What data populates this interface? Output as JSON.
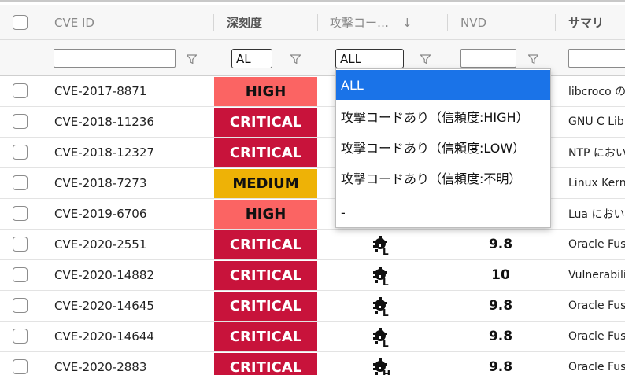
{
  "header": {
    "columns": {
      "cve_id": "CVE ID",
      "severity": "深刻度",
      "exploit": "攻撃コー…",
      "sort_indicator": "↓",
      "nvd": "NVD",
      "summary": "サマリ"
    }
  },
  "filters": {
    "severity_select_value": "AL",
    "exploit_select_value": "ALL"
  },
  "exploit_dropdown": {
    "options": [
      "ALL",
      "攻撃コードあり（信頼度:HIGH）",
      "攻撃コードあり（信頼度:LOW）",
      "攻撃コードあり（信頼度:不明）",
      "-"
    ],
    "selected_index": 0
  },
  "rows": [
    {
      "cve": "CVE-2017-8871",
      "severity": "HIGH",
      "nvd": "",
      "exploit_icon": "",
      "summary": "libcroco の"
    },
    {
      "cve": "CVE-2018-11236",
      "severity": "CRITICAL",
      "nvd": "",
      "exploit_icon": "",
      "summary": "GNU C Libr"
    },
    {
      "cve": "CVE-2018-12327",
      "severity": "CRITICAL",
      "nvd": "",
      "exploit_icon": "",
      "summary": "NTP におい"
    },
    {
      "cve": "CVE-2018-7273",
      "severity": "MEDIUM",
      "nvd": "",
      "exploit_icon": "",
      "summary": "Linux Kern"
    },
    {
      "cve": "CVE-2019-6706",
      "severity": "HIGH",
      "nvd": "",
      "exploit_icon": "",
      "summary": "Lua におい"
    },
    {
      "cve": "CVE-2020-2551",
      "severity": "CRITICAL",
      "nvd": "9.8",
      "exploit_icon": "L",
      "summary": "Oracle Fus"
    },
    {
      "cve": "CVE-2020-14882",
      "severity": "CRITICAL",
      "nvd": "10",
      "exploit_icon": "L",
      "summary": "Vulnerabili"
    },
    {
      "cve": "CVE-2020-14645",
      "severity": "CRITICAL",
      "nvd": "9.8",
      "exploit_icon": "L",
      "summary": "Oracle Fus"
    },
    {
      "cve": "CVE-2020-14644",
      "severity": "CRITICAL",
      "nvd": "9.8",
      "exploit_icon": "L",
      "summary": "Oracle Fus"
    },
    {
      "cve": "CVE-2020-2883",
      "severity": "CRITICAL",
      "nvd": "9.8",
      "exploit_icon": "H",
      "summary": "Oracle Fus"
    }
  ]
}
